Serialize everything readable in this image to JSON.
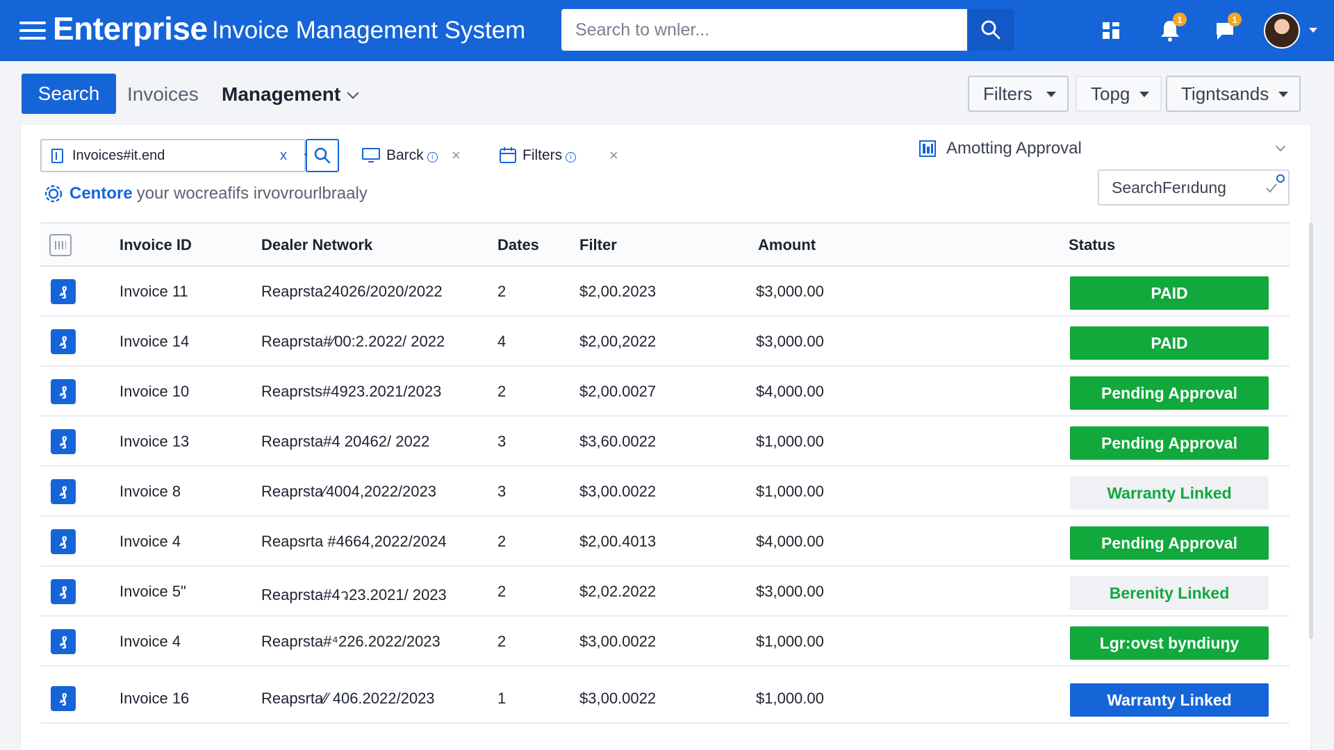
{
  "header": {
    "brand": "Enterprise",
    "app_title": "Invoice Management System",
    "search_placeholder": "Search to wnler...",
    "icons": [
      "menu-icon",
      "search-icon",
      "grid-icon",
      "bell-icon",
      "chat-icon",
      "avatar"
    ],
    "notif_count": "1",
    "chat_count": "1"
  },
  "tabs": {
    "search": "Search",
    "invoices": "Invoices",
    "management": "Management"
  },
  "toolbar": {
    "filters": "Filters",
    "topg": "Topg",
    "tigntsands": "Tigntsands"
  },
  "filters": {
    "input_value": "Invoices#it.end",
    "clear": "x",
    "chip_barck": "Barck",
    "chip_filters": "Filters",
    "chip_info": "i",
    "chip_close": "×",
    "hint_strong": "Centore",
    "hint_text": "your wocreafifs irvovrourlbraaly",
    "approval_label": "Amotting Approval",
    "pending_value": "SearchFerıdung"
  },
  "table": {
    "headers": {
      "invoice_id": "Invoice ID",
      "dealer": "Dealer Network",
      "dates": "Dates",
      "filter": "Filter",
      "amount": "Amount",
      "status": "Status"
    },
    "rows": [
      {
        "icon": "₰",
        "invoice": "Invoice 11",
        "dealer": "Reaprsta24026/2020/2022",
        "dates": "2",
        "filter": "$2,00.2023",
        "amount": "$3,000.00",
        "status": "PAID",
        "style": "green"
      },
      {
        "icon": "₰",
        "invoice": "Invoice 14",
        "dealer": "Reaprsta#⁄00:2.2022/ 2022",
        "dates": "4",
        "filter": "$2,00,2022",
        "amount": "$3,000.00",
        "status": "PAID",
        "style": "green"
      },
      {
        "icon": "₰",
        "invoice": "Invoice 10",
        "dealer": "Reaprsts#4923.2021/2023",
        "dates": "2",
        "filter": "$2,00.0027",
        "amount": "$4,000.00",
        "status": "Pending Approval",
        "style": "green"
      },
      {
        "icon": "₰",
        "invoice": "Invoice 13",
        "dealer": "Reaprsta#4 20462/ 2022",
        "dates": "3",
        "filter": "$3,60.0022",
        "amount": "$1,000.00",
        "status": "Pending Approval",
        "style": "green"
      },
      {
        "icon": "₰",
        "invoice": "Invoice 8",
        "dealer": "Reaprsta⁄4004,2022/2023",
        "dates": "3",
        "filter": "$3,00.0022",
        "amount": "$1,000.00",
        "status": "Warranty Linked",
        "style": "grey"
      },
      {
        "icon": "₰",
        "invoice": "Invoice 4",
        "dealer": "Reapsrta #4664,2022/2024",
        "dates": "2",
        "filter": "$2,00.4013",
        "amount": "$4,000.00",
        "status": "Pending Approval",
        "style": "green"
      },
      {
        "icon": "₰",
        "invoice": "Invoice 5\"",
        "dealer": "Reaprsta#4ว23.2021/ 2023",
        "dates": "2",
        "filter": "$2,02.2022",
        "amount": "$3,000.00",
        "status": "Berenity Linked",
        "style": "grey"
      },
      {
        "icon": "₰",
        "invoice": "Invoice 4",
        "dealer": "Reaprsta#⁴226.2022/2023",
        "dates": "2",
        "filter": "$3,00.0022",
        "amount": "$1,000.00",
        "status": "Lgr:ovst byndiuŋy",
        "style": "green"
      },
      {
        "icon": "₰",
        "invoice": "Invoice 16",
        "dealer": "Reapsrta⁄⁄ 406.2022/2023",
        "dates": "1",
        "filter": "$3,00.0022",
        "amount": "$1,000.00",
        "status": "Warranty Linked",
        "style": "blue"
      }
    ]
  },
  "colors": {
    "primary": "#1565d8",
    "success": "#11a83c",
    "neutral_status": "#eff1f4"
  }
}
